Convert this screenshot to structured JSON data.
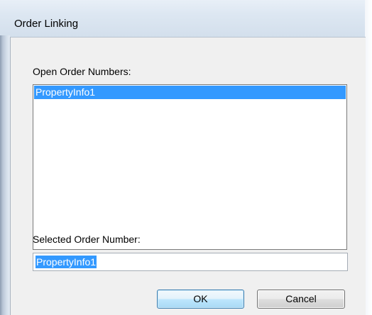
{
  "window": {
    "title": "Order Linking"
  },
  "open_orders": {
    "label": "Open Order Numbers:",
    "items": [
      "PropertyInfo1"
    ],
    "selected_index": 0
  },
  "selected_order": {
    "label": "Selected Order Number:",
    "value": "PropertyInfo1"
  },
  "buttons": {
    "ok_label": "OK",
    "cancel_label": "Cancel"
  },
  "colors": {
    "selection": "#3399ff",
    "ok_border": "#3c7fb1"
  }
}
